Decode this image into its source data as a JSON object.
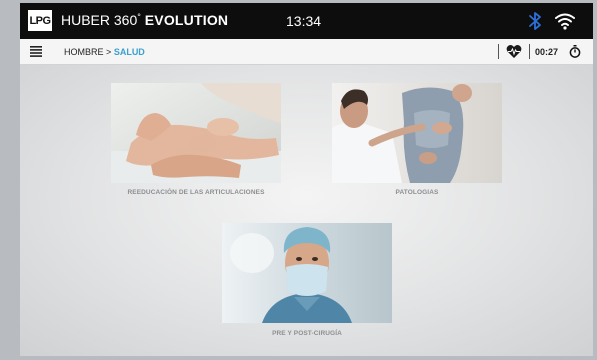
{
  "topbar": {
    "logo": "LPG",
    "title_prefix": "HUBER 360",
    "title_degree": "°",
    "title_bold": "EVOLUTION",
    "time": "13:34",
    "icons": [
      "bluetooth-icon",
      "wifi-icon"
    ]
  },
  "navbar": {
    "breadcrumb_parent": "HOMBRE",
    "breadcrumb_separator": ">",
    "breadcrumb_current": "SALUD",
    "timer": "00:27",
    "icons": [
      "menu-icon",
      "heart-rate-icon",
      "stopwatch-icon"
    ]
  },
  "cards": [
    {
      "label": "REEDUCACIÓN DE LAS ARTICULACIONES"
    },
    {
      "label": "PATOLOGIAS"
    },
    {
      "label": "PRE Y POST-CIRUGÍA"
    }
  ],
  "colors": {
    "topbar_bg": "#0d0d0d",
    "accent": "#3aa0cc",
    "bluetooth": "#2d6fd8",
    "caption": "#8c8e91"
  }
}
